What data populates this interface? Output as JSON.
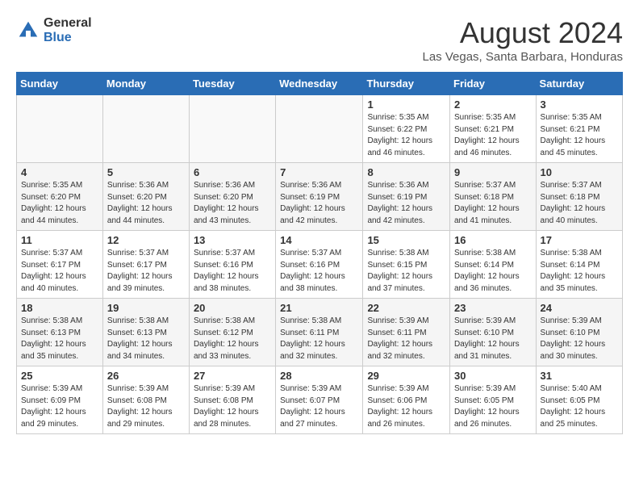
{
  "logo": {
    "general": "General",
    "blue": "Blue"
  },
  "title": {
    "month_year": "August 2024",
    "location": "Las Vegas, Santa Barbara, Honduras"
  },
  "headers": [
    "Sunday",
    "Monday",
    "Tuesday",
    "Wednesday",
    "Thursday",
    "Friday",
    "Saturday"
  ],
  "weeks": [
    [
      {
        "day": "",
        "info": ""
      },
      {
        "day": "",
        "info": ""
      },
      {
        "day": "",
        "info": ""
      },
      {
        "day": "",
        "info": ""
      },
      {
        "day": "1",
        "info": "Sunrise: 5:35 AM\nSunset: 6:22 PM\nDaylight: 12 hours\nand 46 minutes."
      },
      {
        "day": "2",
        "info": "Sunrise: 5:35 AM\nSunset: 6:21 PM\nDaylight: 12 hours\nand 46 minutes."
      },
      {
        "day": "3",
        "info": "Sunrise: 5:35 AM\nSunset: 6:21 PM\nDaylight: 12 hours\nand 45 minutes."
      }
    ],
    [
      {
        "day": "4",
        "info": "Sunrise: 5:35 AM\nSunset: 6:20 PM\nDaylight: 12 hours\nand 44 minutes."
      },
      {
        "day": "5",
        "info": "Sunrise: 5:36 AM\nSunset: 6:20 PM\nDaylight: 12 hours\nand 44 minutes."
      },
      {
        "day": "6",
        "info": "Sunrise: 5:36 AM\nSunset: 6:20 PM\nDaylight: 12 hours\nand 43 minutes."
      },
      {
        "day": "7",
        "info": "Sunrise: 5:36 AM\nSunset: 6:19 PM\nDaylight: 12 hours\nand 42 minutes."
      },
      {
        "day": "8",
        "info": "Sunrise: 5:36 AM\nSunset: 6:19 PM\nDaylight: 12 hours\nand 42 minutes."
      },
      {
        "day": "9",
        "info": "Sunrise: 5:37 AM\nSunset: 6:18 PM\nDaylight: 12 hours\nand 41 minutes."
      },
      {
        "day": "10",
        "info": "Sunrise: 5:37 AM\nSunset: 6:18 PM\nDaylight: 12 hours\nand 40 minutes."
      }
    ],
    [
      {
        "day": "11",
        "info": "Sunrise: 5:37 AM\nSunset: 6:17 PM\nDaylight: 12 hours\nand 40 minutes."
      },
      {
        "day": "12",
        "info": "Sunrise: 5:37 AM\nSunset: 6:17 PM\nDaylight: 12 hours\nand 39 minutes."
      },
      {
        "day": "13",
        "info": "Sunrise: 5:37 AM\nSunset: 6:16 PM\nDaylight: 12 hours\nand 38 minutes."
      },
      {
        "day": "14",
        "info": "Sunrise: 5:37 AM\nSunset: 6:16 PM\nDaylight: 12 hours\nand 38 minutes."
      },
      {
        "day": "15",
        "info": "Sunrise: 5:38 AM\nSunset: 6:15 PM\nDaylight: 12 hours\nand 37 minutes."
      },
      {
        "day": "16",
        "info": "Sunrise: 5:38 AM\nSunset: 6:14 PM\nDaylight: 12 hours\nand 36 minutes."
      },
      {
        "day": "17",
        "info": "Sunrise: 5:38 AM\nSunset: 6:14 PM\nDaylight: 12 hours\nand 35 minutes."
      }
    ],
    [
      {
        "day": "18",
        "info": "Sunrise: 5:38 AM\nSunset: 6:13 PM\nDaylight: 12 hours\nand 35 minutes."
      },
      {
        "day": "19",
        "info": "Sunrise: 5:38 AM\nSunset: 6:13 PM\nDaylight: 12 hours\nand 34 minutes."
      },
      {
        "day": "20",
        "info": "Sunrise: 5:38 AM\nSunset: 6:12 PM\nDaylight: 12 hours\nand 33 minutes."
      },
      {
        "day": "21",
        "info": "Sunrise: 5:38 AM\nSunset: 6:11 PM\nDaylight: 12 hours\nand 32 minutes."
      },
      {
        "day": "22",
        "info": "Sunrise: 5:39 AM\nSunset: 6:11 PM\nDaylight: 12 hours\nand 32 minutes."
      },
      {
        "day": "23",
        "info": "Sunrise: 5:39 AM\nSunset: 6:10 PM\nDaylight: 12 hours\nand 31 minutes."
      },
      {
        "day": "24",
        "info": "Sunrise: 5:39 AM\nSunset: 6:10 PM\nDaylight: 12 hours\nand 30 minutes."
      }
    ],
    [
      {
        "day": "25",
        "info": "Sunrise: 5:39 AM\nSunset: 6:09 PM\nDaylight: 12 hours\nand 29 minutes."
      },
      {
        "day": "26",
        "info": "Sunrise: 5:39 AM\nSunset: 6:08 PM\nDaylight: 12 hours\nand 29 minutes."
      },
      {
        "day": "27",
        "info": "Sunrise: 5:39 AM\nSunset: 6:08 PM\nDaylight: 12 hours\nand 28 minutes."
      },
      {
        "day": "28",
        "info": "Sunrise: 5:39 AM\nSunset: 6:07 PM\nDaylight: 12 hours\nand 27 minutes."
      },
      {
        "day": "29",
        "info": "Sunrise: 5:39 AM\nSunset: 6:06 PM\nDaylight: 12 hours\nand 26 minutes."
      },
      {
        "day": "30",
        "info": "Sunrise: 5:39 AM\nSunset: 6:05 PM\nDaylight: 12 hours\nand 26 minutes."
      },
      {
        "day": "31",
        "info": "Sunrise: 5:40 AM\nSunset: 6:05 PM\nDaylight: 12 hours\nand 25 minutes."
      }
    ]
  ]
}
